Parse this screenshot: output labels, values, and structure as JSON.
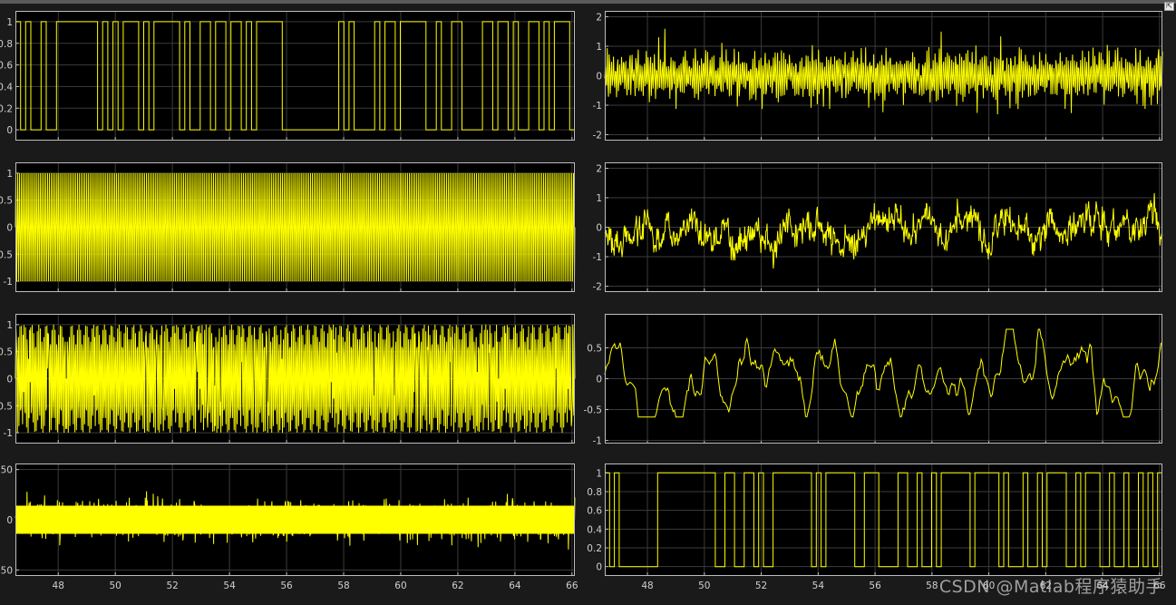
{
  "colors": {
    "background": "#1a1a1a",
    "plot_background": "#000000",
    "trace": "#ffff00",
    "grid": "#3b3b3b",
    "axes": "#bdbdbd",
    "tick_text": "#d0d0d0"
  },
  "toolbar": {
    "restore_icon": "restore-window-icon"
  },
  "watermark": "CSDN @Matlab程序猿助手",
  "chart_data": [
    {
      "type": "line",
      "title": "",
      "signal": "binary-square",
      "xlim": [
        46.5,
        66.1
      ],
      "ylim": [
        -0.1,
        1.1
      ],
      "yticks": [
        "0",
        "0.2",
        "0.4",
        "0.6",
        "0.8",
        "1"
      ],
      "xtick_labels_shown": false,
      "grid": true,
      "series": [
        {
          "values": [
            1,
            0,
            1,
            0,
            0,
            1,
            0,
            0,
            1,
            1,
            1,
            1,
            1,
            1,
            1,
            1,
            0,
            1,
            0,
            1,
            0,
            1,
            1,
            1,
            0,
            1,
            0,
            1,
            1,
            1,
            1,
            1,
            0,
            1,
            0,
            0,
            1,
            1,
            0,
            1,
            1,
            0,
            1,
            1,
            0,
            1,
            0,
            1,
            1,
            1,
            1,
            1,
            0,
            0,
            0,
            0,
            0,
            0,
            0,
            0,
            0,
            0,
            0,
            1,
            0,
            1,
            0,
            0,
            0,
            0,
            1,
            0,
            1,
            1,
            0,
            1,
            1,
            1,
            1,
            1,
            0,
            0,
            1,
            0,
            0,
            1,
            1,
            0,
            0,
            0,
            0,
            1,
            1,
            0,
            1,
            1,
            0,
            1,
            0,
            0,
            1,
            1,
            0,
            1,
            0,
            1,
            1,
            1,
            0
          ]
        }
      ]
    },
    {
      "type": "line",
      "title": "",
      "signal": "narrowband-noise",
      "xlim": [
        46.5,
        66.1
      ],
      "ylim": [
        -2.2,
        2.2
      ],
      "yticks": [
        "-2",
        "-1",
        "0",
        "1",
        "2"
      ],
      "xtick_labels_shown": false,
      "grid": true,
      "series": [
        {
          "amplitude": 0.55,
          "peak": 1.6
        }
      ]
    },
    {
      "type": "line",
      "title": "",
      "signal": "carrier",
      "xlim": [
        46.5,
        66.1
      ],
      "ylim": [
        -1.2,
        1.2
      ],
      "yticks": [
        "-1",
        "-0.5",
        "0",
        "0.5",
        "1"
      ],
      "xtick_labels_shown": false,
      "grid": true,
      "series": [
        {
          "amplitude": 1
        }
      ]
    },
    {
      "type": "line",
      "title": "",
      "signal": "noisy-received",
      "xlim": [
        46.5,
        66.1
      ],
      "ylim": [
        -2.2,
        2.2
      ],
      "yticks": [
        "-2",
        "-1",
        "0",
        "1",
        "2"
      ],
      "xtick_labels_shown": false,
      "grid": true,
      "series": [
        {
          "amplitude": 0.5,
          "peak": 1.6
        }
      ]
    },
    {
      "type": "line",
      "title": "",
      "signal": "phase-modulated",
      "xlim": [
        46.5,
        66.1
      ],
      "ylim": [
        -1.2,
        1.2
      ],
      "yticks": [
        "-1",
        "-0.5",
        "0",
        "0.5",
        "1"
      ],
      "xtick_labels_shown": false,
      "grid": true,
      "series": [
        {
          "amplitude": 1
        }
      ]
    },
    {
      "type": "line",
      "title": "",
      "signal": "filtered",
      "xlim": [
        46.5,
        66.1
      ],
      "ylim": [
        -1.05,
        1.05
      ],
      "yticks": [
        "-1",
        "-0.5",
        "0",
        "0.5"
      ],
      "xtick_labels_shown": false,
      "grid": true,
      "series": [
        {
          "amplitude": 0.4,
          "peak": 0.8
        }
      ]
    },
    {
      "type": "line",
      "title": "",
      "signal": "awgn",
      "xlim": [
        46.5,
        66.1
      ],
      "ylim": [
        -56,
        56
      ],
      "yticks": [
        "-50",
        "0",
        "50"
      ],
      "xticks": [
        "48",
        "50",
        "52",
        "54",
        "56",
        "58",
        "60",
        "62",
        "64",
        "66"
      ],
      "xtick_labels_shown": true,
      "grid": true,
      "series": [
        {
          "sigma": 9,
          "peak": 33
        }
      ]
    },
    {
      "type": "line",
      "title": "",
      "signal": "binary-square",
      "xlim": [
        46.5,
        66.1
      ],
      "ylim": [
        -0.1,
        1.1
      ],
      "yticks": [
        "0",
        "0.2",
        "0.4",
        "0.6",
        "0.8",
        "1"
      ],
      "xticks": [
        "48",
        "50",
        "52",
        "54",
        "56",
        "58",
        "60",
        "62",
        "64",
        "66"
      ],
      "xtick_labels_shown": true,
      "grid": true,
      "series": [
        {
          "values": [
            1,
            0,
            1,
            0,
            0,
            0,
            0,
            0,
            0,
            0,
            0,
            1,
            1,
            1,
            1,
            1,
            1,
            1,
            1,
            1,
            1,
            1,
            1,
            0,
            0,
            1,
            1,
            0,
            0,
            1,
            1,
            0,
            1,
            0,
            0,
            1,
            1,
            1,
            1,
            1,
            1,
            1,
            1,
            0,
            1,
            0,
            1,
            1,
            1,
            1,
            1,
            1,
            0,
            0,
            1,
            1,
            1,
            0,
            0,
            0,
            0,
            1,
            1,
            0,
            0,
            1,
            0,
            0,
            1,
            0,
            1,
            1,
            1,
            1,
            1,
            1,
            0,
            1,
            1,
            1,
            1,
            1,
            0,
            1,
            0,
            0,
            0,
            1,
            0,
            0,
            1,
            0,
            1,
            1,
            1,
            1,
            0,
            0,
            1,
            0,
            1,
            1,
            1,
            0,
            0,
            1,
            0,
            0,
            1,
            0,
            0,
            1,
            0,
            1,
            0,
            1
          ]
        }
      ]
    }
  ]
}
